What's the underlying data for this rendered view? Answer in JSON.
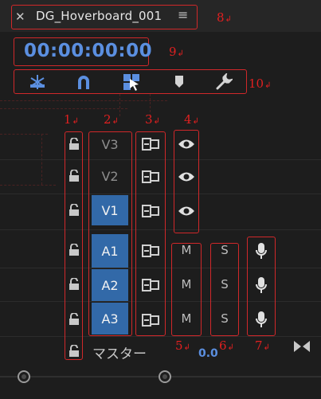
{
  "header": {
    "close_glyph": "✕",
    "sequence_name": "DG_Hoverboard_001",
    "menu_glyph": "≡",
    "callout_8": "8"
  },
  "timecode": {
    "value": "00:00:00:00",
    "callout_9": "9"
  },
  "toolbar": {
    "tools": [
      "snap-ripple-icon",
      "magnet-icon",
      "linked-selection-icon",
      "marker-icon",
      "wrench-icon"
    ],
    "callout_10": "10"
  },
  "columns": {
    "callout_1": "1",
    "callout_2": "2",
    "callout_3": "3",
    "callout_4": "4"
  },
  "video_tracks": [
    {
      "label": "V3",
      "targeted": false
    },
    {
      "label": "V2",
      "targeted": false
    },
    {
      "label": "V1",
      "targeted": true
    }
  ],
  "audio_tracks": [
    {
      "label": "A1",
      "mute": "M",
      "solo": "S"
    },
    {
      "label": "A2",
      "mute": "M",
      "solo": "S"
    },
    {
      "label": "A3",
      "mute": "M",
      "solo": "S"
    }
  ],
  "master": {
    "label": "マスター",
    "volume": "0.0",
    "callout_5": "5",
    "callout_6": "6",
    "callout_7": "7"
  },
  "colors": {
    "accent_blue": "#3269a8",
    "timecode_blue": "#5b8fe0",
    "callout_red": "#d0282a"
  }
}
